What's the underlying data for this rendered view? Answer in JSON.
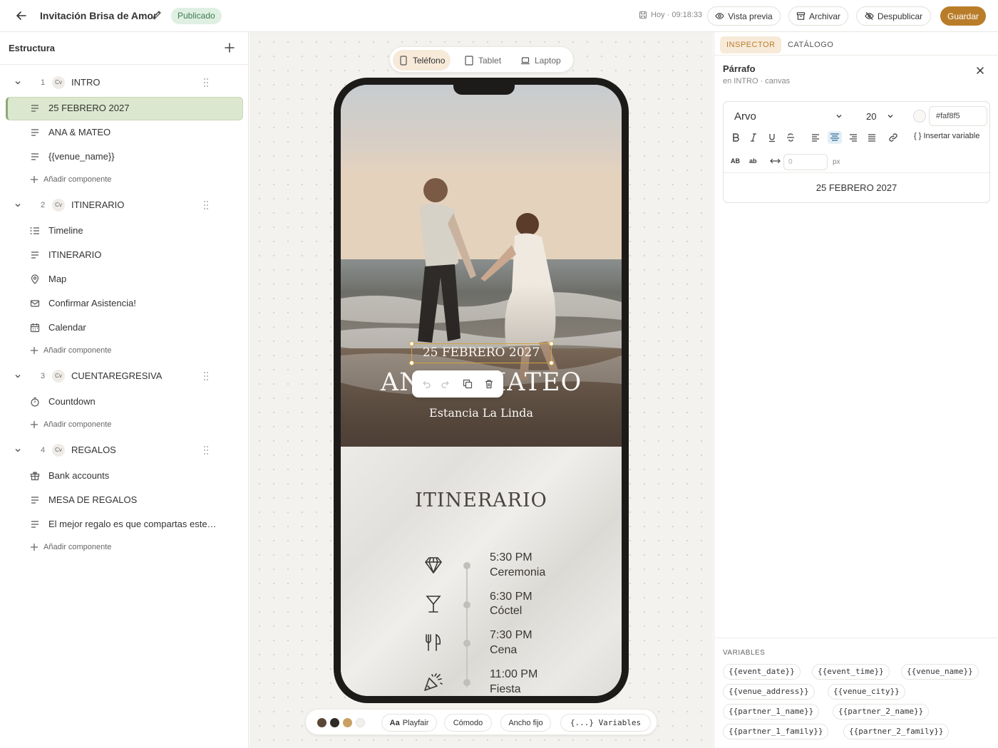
{
  "topbar": {
    "title": "Invitación Brisa de Amor",
    "status": "Publicado",
    "saved": "Hoy · 09:18:33",
    "preview": "Vista previa",
    "archive": "Archivar",
    "unpublish": "Despublicar",
    "save": "Guardar"
  },
  "structure": {
    "title": "Estructura",
    "add_component": "Añadir componente",
    "sections": [
      {
        "num": "1",
        "badge": "Cv",
        "label": "INTRO",
        "items": [
          {
            "icon": "text-lines-icon",
            "label": "25 FEBRERO 2027"
          },
          {
            "icon": "text-lines-icon",
            "label": "ANA & MATEO"
          },
          {
            "icon": "text-lines-icon",
            "label": "{{venue_name}}"
          }
        ]
      },
      {
        "num": "2",
        "badge": "Cv",
        "label": "ITINERARIO",
        "items": [
          {
            "icon": "timeline-icon",
            "label": "Timeline"
          },
          {
            "icon": "text-lines-icon",
            "label": "ITINERARIO"
          },
          {
            "icon": "map-pin-icon",
            "label": "Map"
          },
          {
            "icon": "mail-icon",
            "label": "Confirmar Asistencia!"
          },
          {
            "icon": "calendar-icon",
            "label": "Calendar"
          }
        ]
      },
      {
        "num": "3",
        "badge": "Cv",
        "label": "CUENTAREGRESIVA",
        "items": [
          {
            "icon": "timer-icon",
            "label": "Countdown"
          }
        ]
      },
      {
        "num": "4",
        "badge": "Cv",
        "label": "REGALOS",
        "items": [
          {
            "icon": "gift-icon",
            "label": "Bank accounts"
          },
          {
            "icon": "text-lines-icon",
            "label": "MESA DE REGALOS"
          },
          {
            "icon": "text-lines-icon",
            "label": "El mejor regalo es que compartas este…"
          }
        ]
      }
    ]
  },
  "devices": {
    "phone": "Teléfono",
    "tablet": "Tablet",
    "laptop": "Laptop",
    "active": "phone"
  },
  "hero": {
    "date": "25 FEBRERO 2027",
    "names": "ANA & MATEO",
    "venue": "Estancia La Linda"
  },
  "itinerary": {
    "title": "ITINERARIO",
    "events": [
      {
        "icon": "diamond-icon",
        "time": "5:30 PM",
        "name": "Ceremonia"
      },
      {
        "icon": "cocktail-icon",
        "time": "6:30 PM",
        "name": "Cóctel"
      },
      {
        "icon": "utensils-icon",
        "time": "7:30 PM",
        "name": "Cena"
      },
      {
        "icon": "party-popper-icon",
        "time": "11:00 PM",
        "name": "Fiesta"
      }
    ]
  },
  "bottombar": {
    "swatches": [
      "#5a4636",
      "#2e2a26",
      "#c9a063",
      "#f2f0ec"
    ],
    "font": "Playfair",
    "font_prefix": "Aa",
    "density": "Cómodo",
    "width": "Ancho fijo",
    "variables": "{...} Variables"
  },
  "inspector": {
    "tabs": [
      "INSPECTOR",
      "CATÁLOGO"
    ],
    "element": "Párrafo",
    "context": "en INTRO · canvas",
    "font": "Arvo",
    "size": "20",
    "color": "#faf8f5",
    "color_label": "#faf8f5",
    "insert_variable": "{ } Insertar variable",
    "uppercase": "AB",
    "lowercase": "ab",
    "letter_spacing": "0",
    "unit": "px",
    "preview": "25 FEBRERO 2027",
    "variables_title": "VARIABLES",
    "variables": [
      "{{event_date}}",
      "{{event_time}}",
      "{{venue_name}}",
      "{{venue_address}}",
      "{{venue_city}}",
      "{{partner_1_name}}",
      "{{partner_2_name}}",
      "{{partner_1_family}}",
      "{{partner_2_family}}"
    ]
  },
  "colors": {
    "accent": "#b97d2a",
    "selection": "#d2a23e",
    "published_bg": "#dff0e3"
  }
}
